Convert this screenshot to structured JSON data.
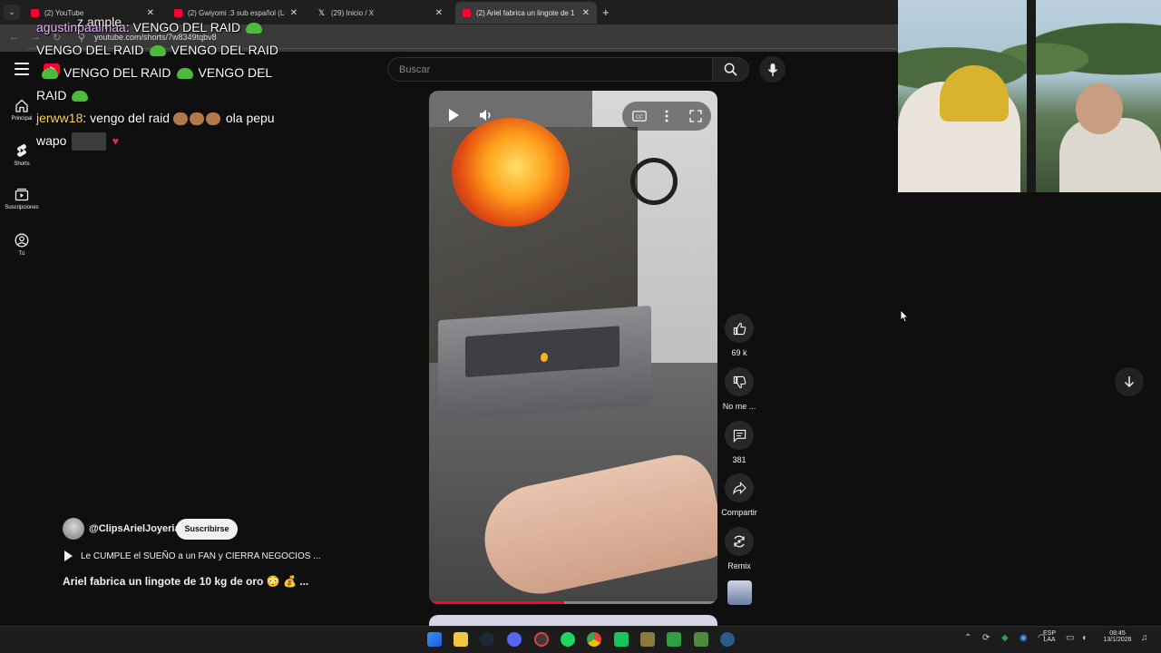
{
  "browser": {
    "tabs": [
      {
        "title": "(2) YouTube",
        "favicon": "youtube-icon"
      },
      {
        "title": "(2) Gwiyomi :3 sub español (LE",
        "favicon": "youtube-icon"
      },
      {
        "title": "(29) Inicio / X",
        "favicon": "x-icon"
      },
      {
        "title": "(2) Ariel fabrica un lingote de 1",
        "favicon": "youtube-icon",
        "active": true
      }
    ],
    "url": "youtube.com/shorts/7w8349tqbv8"
  },
  "youtube": {
    "search_placeholder": "Buscar",
    "guide": [
      {
        "label": "Principal",
        "icon": "home-icon"
      },
      {
        "label": "Shorts",
        "icon": "shorts-icon"
      },
      {
        "label": "Suscripciones",
        "icon": "subscriptions-icon"
      },
      {
        "label": "Tú",
        "icon": "you-icon"
      }
    ],
    "actions": {
      "like_count": "69 k",
      "dislike_label": "No me ...",
      "comments_count": "381",
      "share_label": "Compartir",
      "remix_label": "Remix"
    },
    "channel": "@ClipsArielJoyeria",
    "subscribe_label": "Suscribirse",
    "playlist": "Le CUMPLE el SUEÑO a un FAN y CIERRA NEGOCIOS ...",
    "title": "Ariel fabrica un lingote de 10 kg de oro 😳 💰 ...",
    "progress": 0.47
  },
  "chat": {
    "top_fragment": "z ample.",
    "messages": [
      {
        "user": "agustinpaalmaa",
        "text": "VENGO DEL RAID"
      },
      {
        "fragment1": "VENGO DEL RAID",
        "fragment2": "VENGO DEL RAID"
      },
      {
        "fragment1": "VENGO DEL RAID",
        "fragment2": "VENGO DEL"
      },
      {
        "fragment1": "RAID"
      },
      {
        "user": "jerww18",
        "text": "vengo del raid",
        "text2": "ola pepu"
      },
      {
        "text": "wapo"
      }
    ]
  },
  "taskbar": {
    "lang": "ESP",
    "region": "LAA",
    "time": "08:45",
    "date": "13/1/2026"
  }
}
